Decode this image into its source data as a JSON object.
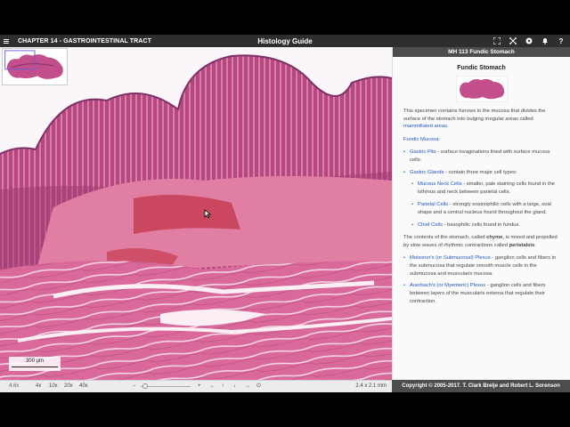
{
  "topbar": {
    "chapter": "CHAPTER 14 - GASTROINTESTINAL TRACT",
    "title": "Histology Guide",
    "icons": [
      "fullscreen-icon",
      "expand-icon",
      "info-icon",
      "bell-icon",
      "help-icon"
    ]
  },
  "viewer": {
    "scale_label": "300 µm"
  },
  "bottombar": {
    "zoom_current": "4.6x",
    "zoom_levels": [
      "4x",
      "10x",
      "20x",
      "40x"
    ],
    "zoom_out": "−",
    "zoom_in": "+",
    "nav": [
      "←",
      "↑",
      "↓",
      "→",
      "⏻"
    ],
    "dimensions": "2.4 x 2.1 mm"
  },
  "panel": {
    "header": "MH 113 Fundic Stomach",
    "title": "Fundic Stomach",
    "intro_text": "This specimen contains furrows in the mucosa that divides the surface of the stomach into bulging irregular areas called",
    "intro_link": "mammillated areas.",
    "fundic_mucosa": "Fundic Mucosa:",
    "gastric_pits_link": "Gastric Pits",
    "gastric_pits_text": " - surface invaginations lined with surface mucous cells.",
    "gastric_glands_link": "Gastric Glands",
    "gastric_glands_text": " - contain three major cell types:",
    "mucous_neck_link": "Mucous Neck Cells",
    "mucous_neck_text": " - smaller, pale staining cells found in the isthmus and neck between parietal cells.",
    "parietal_link": "Parietal Cells",
    "parietal_text": " - strongly eosinophilic cells with a large, oval shape and a central nucleus found throughout the gland.",
    "chief_link": "Chief Cells",
    "chief_text": " - basophilic cells found in fundus.",
    "chyme_pre": "The contents of the stomach, called ",
    "chyme_word": "chyme",
    "chyme_mid": ", is mixed and propelled by slow waves of rhythmic contractions called ",
    "peristalsis_word": "peristalsis",
    "chyme_end": ".",
    "meissner_link": "Meissner's (or Submucosal) Plexus",
    "meissner_text": " - ganglion cells and fibers in the submucosa that regulate smooth muscle cells in the submucosa and muscularis mucosa.",
    "auerbach_link": "Auerbach's (or Myenteric) Plexus",
    "auerbach_text": " - ganglion cells and fibers between layers of the muscularis externa that regulate their contraction."
  },
  "footer": {
    "copyright": "Copyright © 2005-2017. T. Clark Brelje and Robert L. Sorenson"
  }
}
